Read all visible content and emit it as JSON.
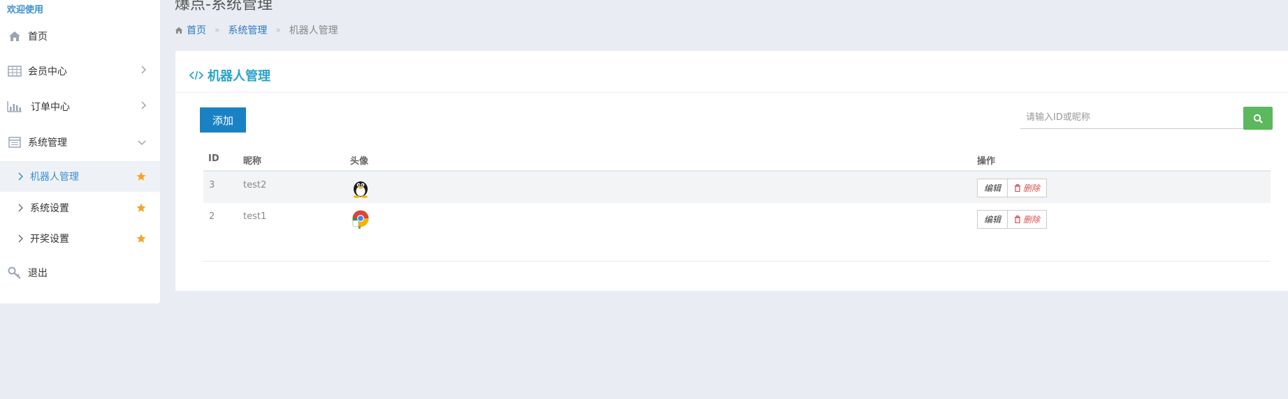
{
  "sidebar": {
    "welcome": "欢迎使用",
    "items": [
      {
        "label": "首页",
        "icon": "home-icon"
      },
      {
        "label": "会员中心",
        "icon": "table-icon"
      },
      {
        "label": "订单中心",
        "icon": "bar-chart-icon"
      },
      {
        "label": "系统管理",
        "icon": "list-icon"
      }
    ],
    "sub_items": [
      {
        "label": "机器人管理",
        "active": true
      },
      {
        "label": "系统设置",
        "active": false
      },
      {
        "label": "开奖设置",
        "active": false
      }
    ],
    "logout": {
      "label": "退出",
      "icon": "key-icon"
    }
  },
  "header": {
    "title": "爆点-系统管理",
    "breadcrumb": [
      "首页",
      "系统管理",
      "机器人管理"
    ]
  },
  "panel": {
    "title": "机器人管理",
    "add_label": "添加",
    "search_placeholder": "请输入ID或昵称"
  },
  "table": {
    "columns": [
      "ID",
      "昵称",
      "头像",
      "操作"
    ],
    "rows": [
      {
        "id": "3",
        "nickname": "test2",
        "avatar": "penguin-avatar"
      },
      {
        "id": "2",
        "nickname": "test1",
        "avatar": "browser-avatar"
      }
    ],
    "edit_label": "编辑",
    "delete_label": "删除"
  },
  "colors": {
    "accent": "#2aa3c9",
    "primary_button": "#1a82c4",
    "search_button": "#5cb85c",
    "delete_text": "#d9534f",
    "star": "#f5a623"
  }
}
